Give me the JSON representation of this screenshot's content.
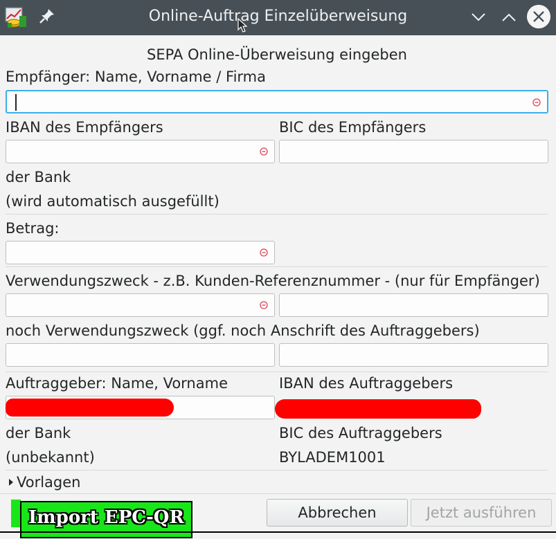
{
  "window": {
    "title": "Online-Auftrag Einzelüberweisung"
  },
  "form": {
    "heading": "SEPA Online-Überweisung eingeben",
    "recipient_label": "Empfänger: Name, Vorname / Firma",
    "recipient_value": "",
    "iban_recipient_label": "IBAN des Empfängers",
    "iban_recipient_value": "",
    "bic_recipient_label": "BIC des Empfängers",
    "bic_recipient_value": "",
    "bank_label": "der Bank",
    "bank_value": "(wird automatisch ausgefüllt)",
    "amount_label": "Betrag:",
    "amount_value": "",
    "purpose_label": "Verwendungszweck - z.B. Kunden-Referenznummer - (nur für Empfänger)",
    "purpose_value_1": "",
    "purpose_value_2": "",
    "purpose2_label": "noch Verwendungszweck (ggf. noch Anschrift des Auftraggebers)",
    "purpose2_value_1": "",
    "purpose2_value_2": "",
    "sender_label": "Auftraggeber: Name, Vorname",
    "sender_iban_label": "IBAN des Auftraggebers",
    "sender_bank_label": "der Bank",
    "sender_bank_value": "(unbekannt)",
    "sender_bic_label": "BIC des Auftraggebers",
    "sender_bic_value": "BYLADEM1001",
    "templates_label": "Vorlagen"
  },
  "buttons": {
    "import_label": "Import EPC-QR",
    "cancel_label": "Abbrechen",
    "execute_label": "Jetzt ausführen"
  },
  "colors": {
    "titlebar": "#475057",
    "focus": "#3daee9",
    "import_green": "#19e619",
    "redaction": "#ff0000"
  }
}
